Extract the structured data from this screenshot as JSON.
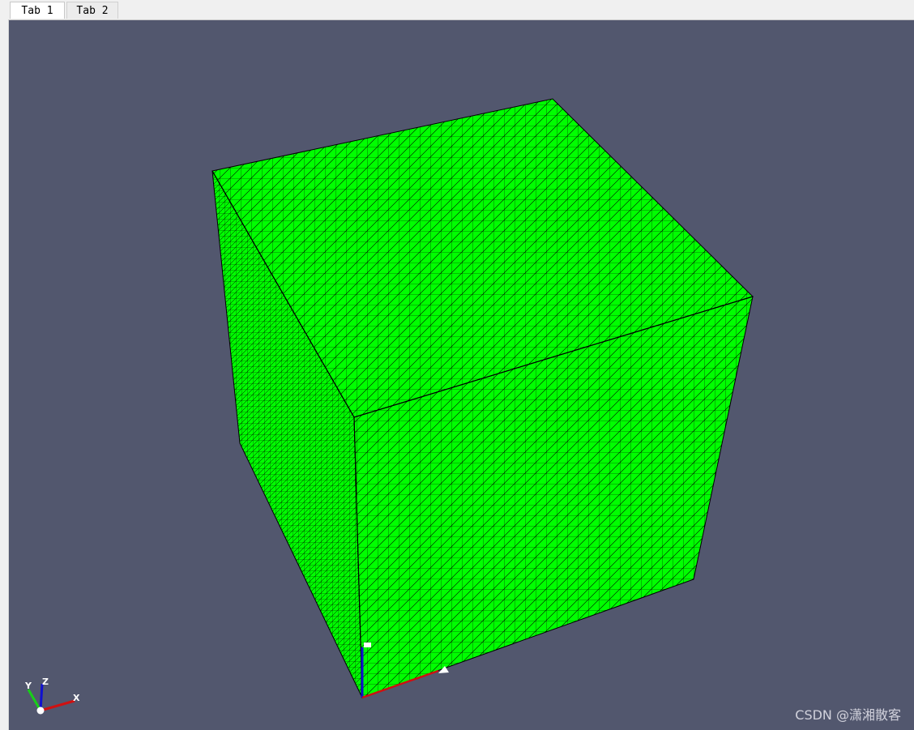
{
  "tabs": [
    {
      "label": "Tab 1",
      "active": true
    },
    {
      "label": "Tab 2",
      "active": false
    }
  ],
  "viewport": {
    "background": "#52576e",
    "mesh_color": "#00ff00",
    "edge_color": "#000000"
  },
  "orientation_axes": {
    "labels": {
      "x": "X",
      "y": "Y",
      "z": "Z"
    },
    "colors": {
      "x": "#d01010",
      "y": "#18d018",
      "z": "#1010d0"
    }
  },
  "watermark": "CSDN @潇湘散客"
}
